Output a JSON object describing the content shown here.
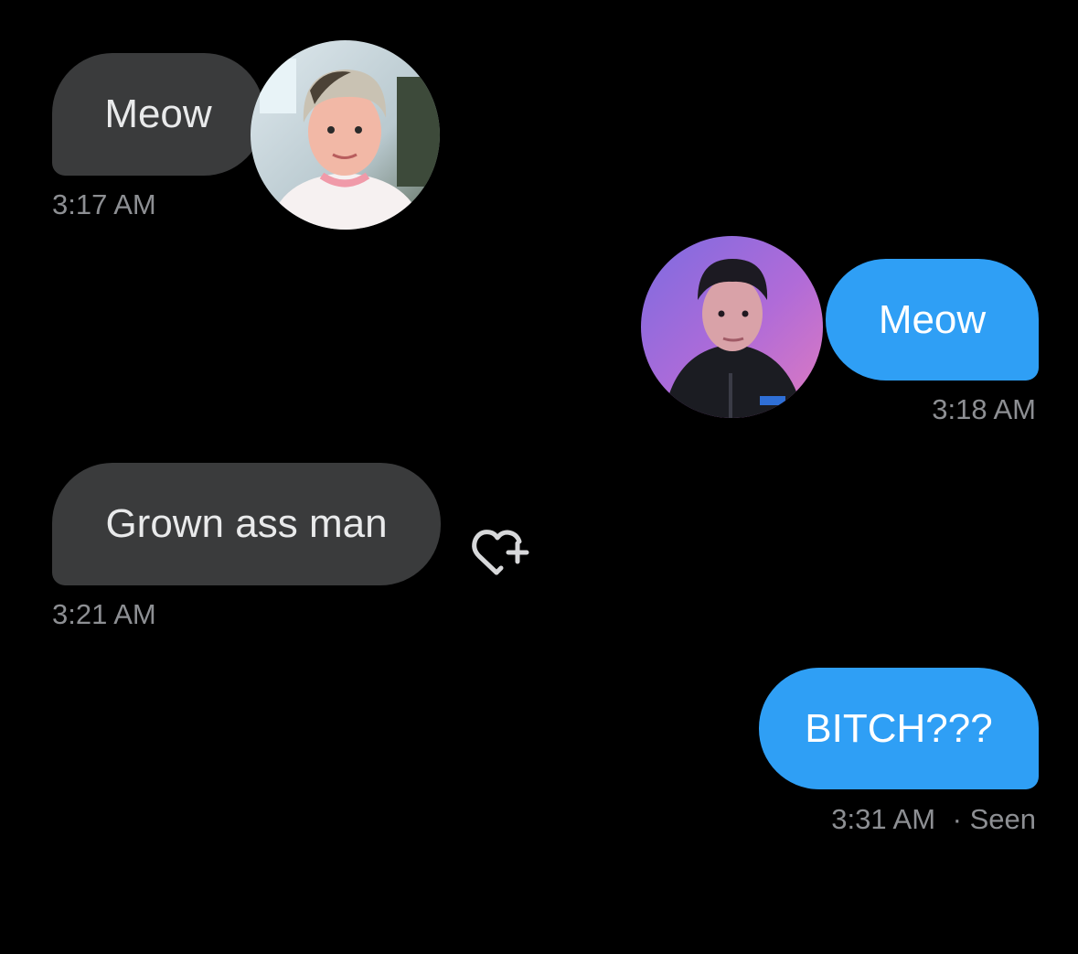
{
  "messages": [
    {
      "text": "Meow",
      "time": "3:17 AM",
      "direction": "incoming"
    },
    {
      "text": "Meow",
      "time": "3:18 AM",
      "direction": "outgoing"
    },
    {
      "text": "Grown ass man",
      "time": "3:21 AM",
      "direction": "incoming"
    },
    {
      "text": "BITCH???",
      "time": "3:31 AM",
      "direction": "outgoing",
      "status": "· Seen"
    }
  ],
  "icons": {
    "react": "heart-plus-icon"
  },
  "colors": {
    "background": "#000000",
    "incoming_bubble": "#3a3b3c",
    "outgoing_bubble": "#2f9ff5",
    "timestamp": "#8d8f93"
  }
}
